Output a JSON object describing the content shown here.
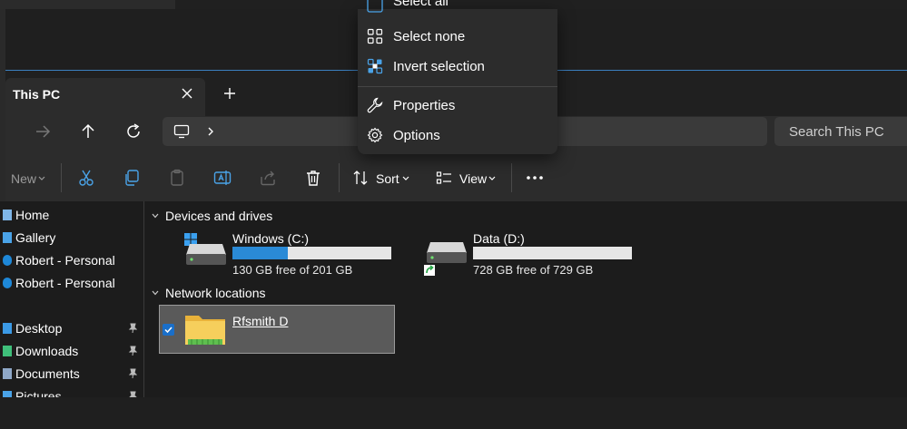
{
  "window": {
    "tab_title": "This PC",
    "search_placeholder": "Search This PC"
  },
  "toolbar": {
    "new_label": "New",
    "sort_label": "Sort",
    "view_label": "View"
  },
  "sidebar": {
    "items": [
      {
        "label": "Home",
        "icon": "home-icon"
      },
      {
        "label": "Gallery",
        "icon": "gallery-icon"
      },
      {
        "label": "Robert - Personal",
        "icon": "cloud-icon"
      },
      {
        "label": "Robert - Personal",
        "icon": "cloud-icon"
      },
      {
        "label": "Desktop",
        "icon": "desktop-icon",
        "pinned": true
      },
      {
        "label": "Downloads",
        "icon": "downloads-icon",
        "pinned": true
      },
      {
        "label": "Documents",
        "icon": "documents-icon",
        "pinned": true
      },
      {
        "label": "Pictures",
        "icon": "pictures-icon",
        "pinned": true
      }
    ]
  },
  "content": {
    "devices_title": "Devices and drives",
    "network_title": "Network locations",
    "drives": [
      {
        "name": "Windows (C:)",
        "free_text": "130 GB free of 201 GB",
        "used_fraction": 0.35
      },
      {
        "name": "Data (D:)",
        "free_text": "728 GB free of 729 GB",
        "used_fraction": 0.0
      }
    ],
    "network": [
      {
        "name": "Rfsmith D",
        "selected": true
      }
    ]
  },
  "menu": {
    "items": [
      {
        "label": "Select all"
      },
      {
        "label": "Select none"
      },
      {
        "label": "Invert selection"
      },
      {
        "label": "Properties"
      },
      {
        "label": "Options"
      }
    ]
  },
  "colors": {
    "accent": "#2a8ad6",
    "background": "#1c1c1c",
    "surface": "#2c2c2c"
  }
}
